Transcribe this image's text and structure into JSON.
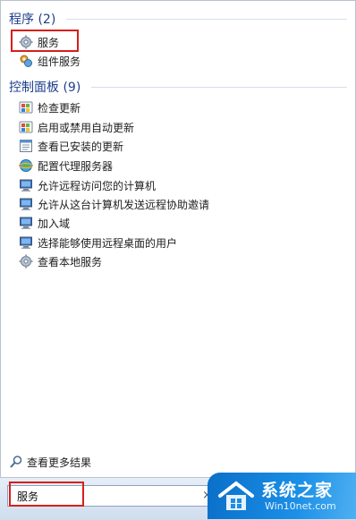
{
  "programs": {
    "header": "程序 (2)",
    "items": [
      {
        "label": "服务",
        "icon": "gears-icon"
      },
      {
        "label": "组件服务",
        "icon": "component-services-icon"
      }
    ]
  },
  "control_panel": {
    "header": "控制面板 (9)",
    "items": [
      {
        "label": "检查更新",
        "icon": "windows-update-icon"
      },
      {
        "label": "启用或禁用自动更新",
        "icon": "windows-update-icon"
      },
      {
        "label": "查看已安装的更新",
        "icon": "installed-updates-icon"
      },
      {
        "label": "配置代理服务器",
        "icon": "internet-options-icon"
      },
      {
        "label": "允许远程访问您的计算机",
        "icon": "system-icon"
      },
      {
        "label": "允许从这台计算机发送远程协助邀请",
        "icon": "system-icon"
      },
      {
        "label": "加入域",
        "icon": "system-icon"
      },
      {
        "label": "选择能够使用远程桌面的用户",
        "icon": "system-icon"
      },
      {
        "label": "查看本地服务",
        "icon": "gears-icon"
      }
    ]
  },
  "more_results": "查看更多结果",
  "search": {
    "value": "服务",
    "clear": "×"
  },
  "watermark": {
    "main": "系统之家",
    "sub": "Win10net.com"
  },
  "colors": {
    "header": "#1e3f8c",
    "highlight": "#d6201c",
    "watermark": "#1b8fe6"
  }
}
